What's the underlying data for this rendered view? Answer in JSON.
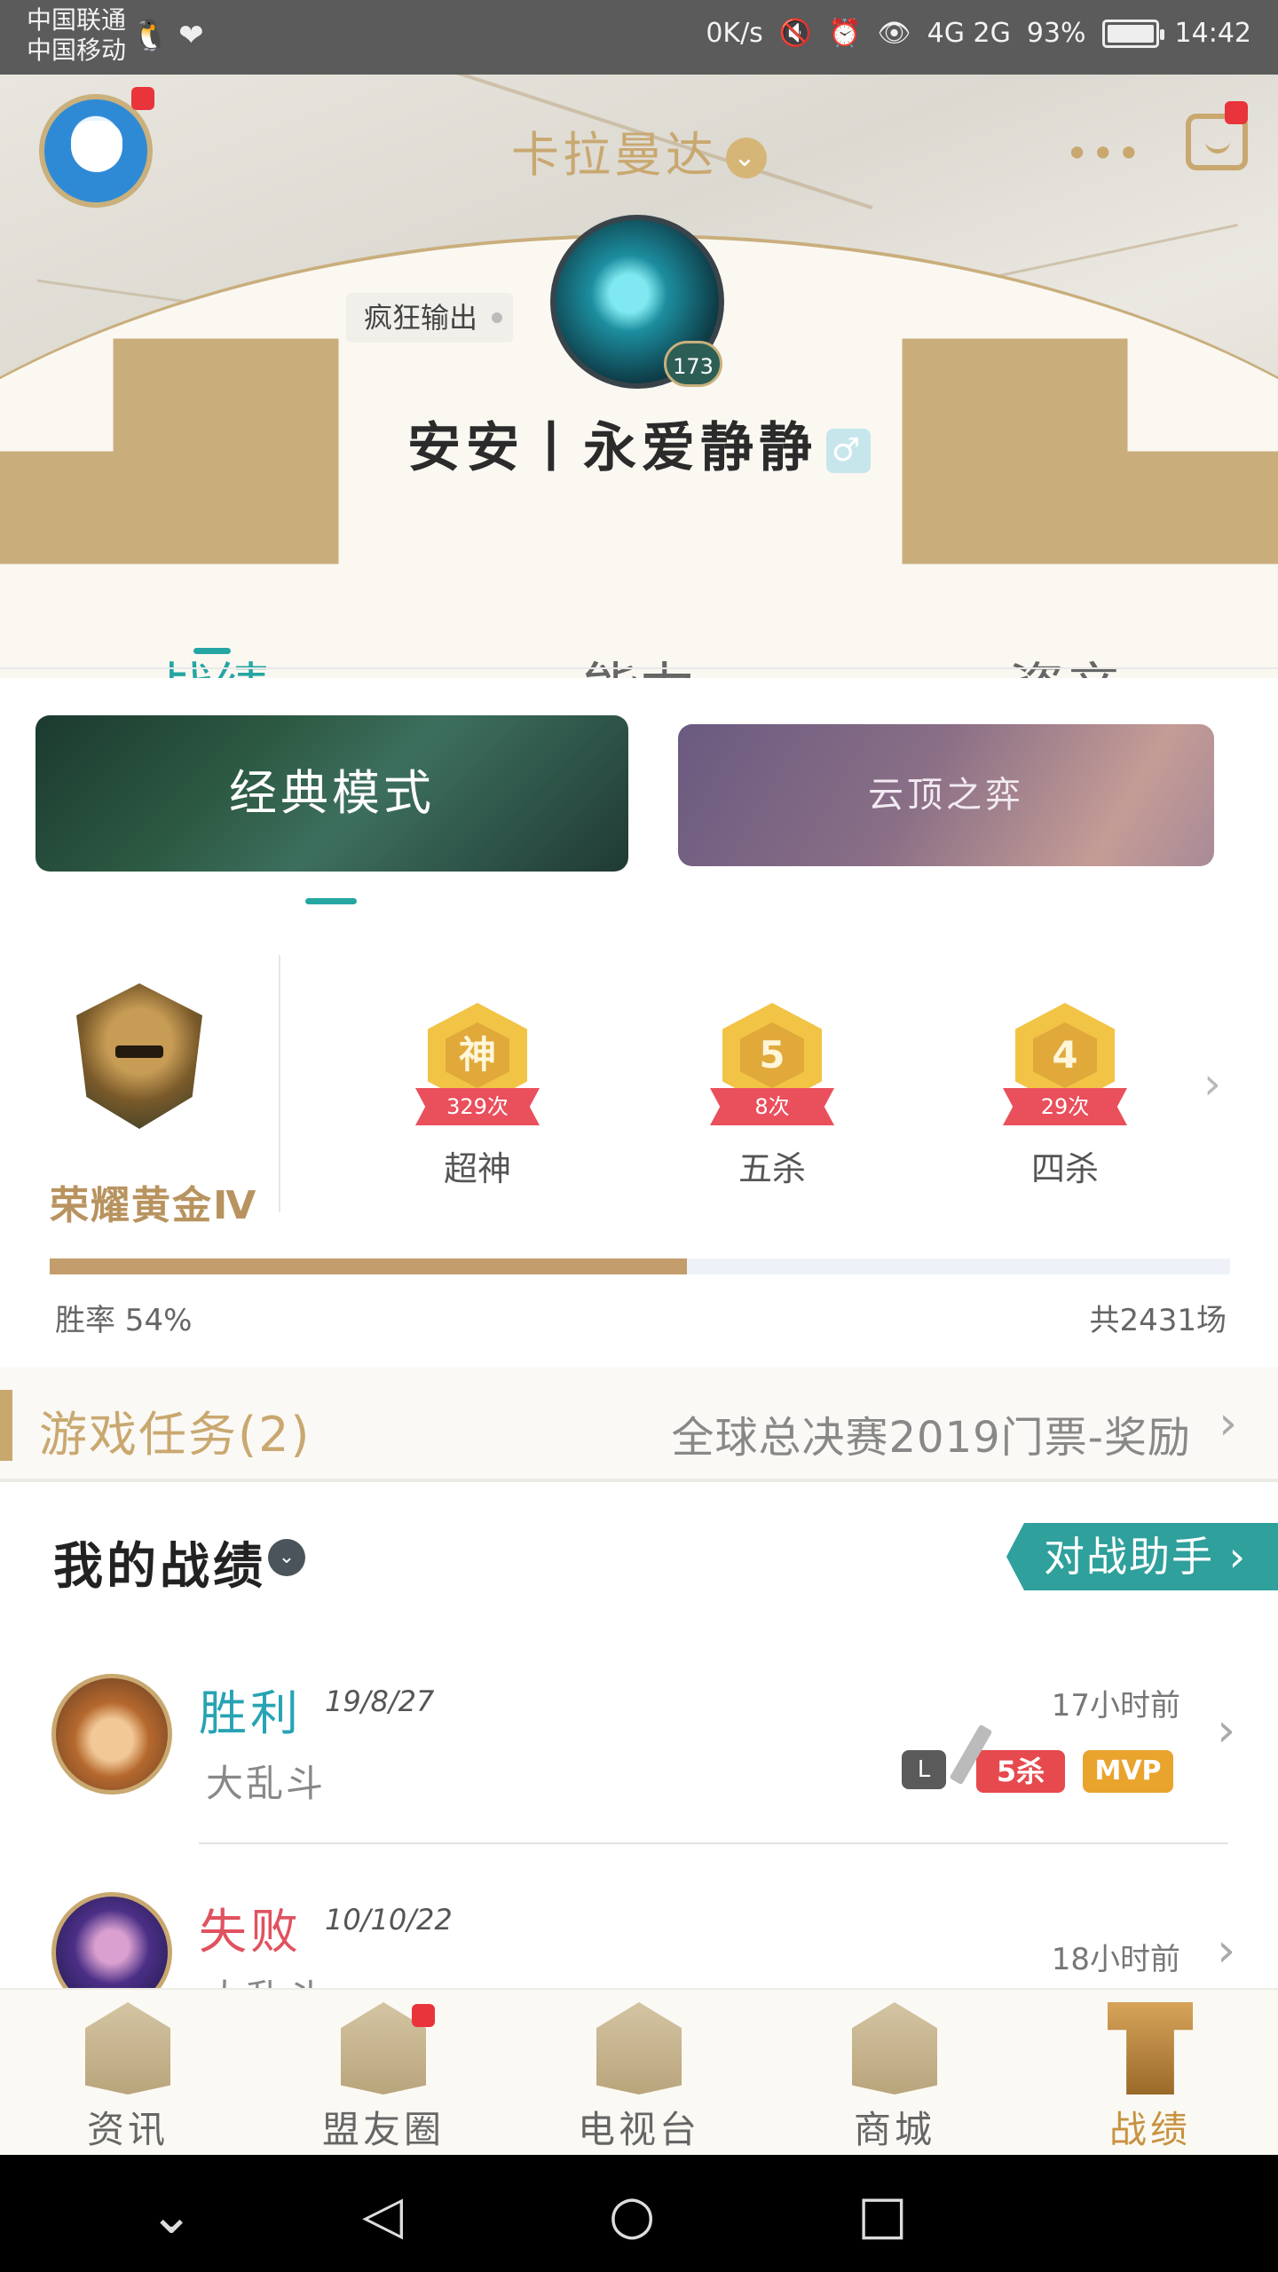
{
  "status_bar": {
    "carrier1": "中国联通",
    "carrier2": "中国移动",
    "left_icons": "🐧 ❤",
    "speed": "0K/s",
    "signal": "4G 2G",
    "battery": "93%",
    "time": "14:42"
  },
  "header": {
    "server_name": "卡拉曼达",
    "server_arrow": "⌄",
    "more": "•••",
    "title_tag": "疯狂输出",
    "hero_level": "173",
    "nickname": "安安丨永爱静静",
    "gender": "♂"
  },
  "tabs": [
    {
      "label": "战绩",
      "active": true
    },
    {
      "label": "能力",
      "active": false
    },
    {
      "label": "资产",
      "active": false
    }
  ],
  "modes": {
    "classic": "经典模式",
    "tft": "云顶之弈"
  },
  "rank": {
    "label": "荣耀黄金Ⅳ"
  },
  "badges": [
    {
      "icon": "神",
      "count": "329次",
      "name": "超神"
    },
    {
      "icon": "5",
      "count": "8次",
      "name": "五杀"
    },
    {
      "icon": "4",
      "count": "29次",
      "name": "四杀"
    }
  ],
  "win_rate": {
    "label": "胜率 54%",
    "value": 0.54,
    "total": "共2431场"
  },
  "task": {
    "title": "游戏任务(2)",
    "reward": "全球总决赛2019门票-奖励"
  },
  "records": {
    "title": "我的战绩",
    "assistant_button": "对战助手 ›",
    "matches": [
      {
        "result": "胜利",
        "date": "19/8/27",
        "mode": "大乱斗",
        "time_ago": "17小时前",
        "kill_tag": "5杀",
        "mvp_tag": "MVP",
        "video_icon": "L"
      },
      {
        "result": "失败",
        "date": "10/10/22",
        "mode": "大乱斗",
        "time_ago": "18小时前"
      }
    ]
  },
  "bottom_nav": [
    {
      "label": "资讯",
      "active": false
    },
    {
      "label": "盟友圈",
      "active": false
    },
    {
      "label": "电视台",
      "active": false
    },
    {
      "label": "商城",
      "active": false
    },
    {
      "label": "战绩",
      "active": true
    }
  ],
  "colors": {
    "accent_teal": "#26a6a3",
    "gold": "#c9a870",
    "win": "#27a3b4",
    "lose": "#e0525f"
  }
}
